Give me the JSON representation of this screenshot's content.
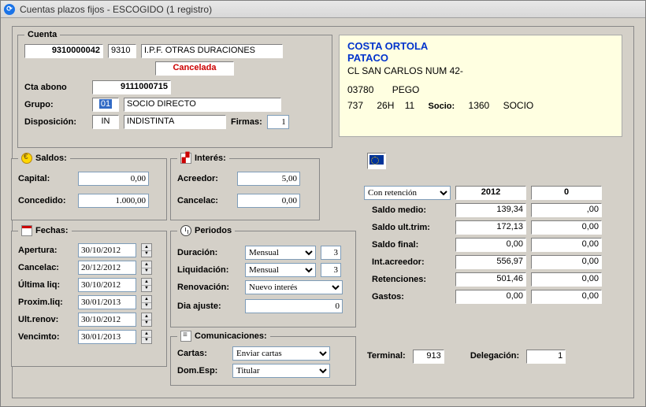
{
  "window": {
    "title": "Cuentas plazos fijos - ESCOGIDO (1 registro)"
  },
  "cuenta": {
    "legend": "Cuenta",
    "num": "9310000042",
    "tipo_cod": "9310",
    "tipo_desc": "I.P.F. OTRAS DURACIONES",
    "estado": "Cancelada",
    "cta_abono_label": "Cta abono",
    "cta_abono": "9111000715",
    "grupo_label": "Grupo:",
    "grupo_cod": "01",
    "grupo_desc": "SOCIO DIRECTO",
    "disposicion_label": "Disposición:",
    "disposicion_cod": "IN",
    "disposicion_desc": "INDISTINTA",
    "firmas_label": "Firmas:",
    "firmas": "1"
  },
  "cliente": {
    "nombre1": "COSTA ORTOLA",
    "nombre2": "PATACO",
    "direccion": "CL SAN CARLOS NUM 42-",
    "cp": "03780",
    "poblacion": "PEGO",
    "id1": "737",
    "id2": "26H",
    "id3": "11",
    "socio_label": "Socio:",
    "socio_num": "1360",
    "socio_tipo": "SOCIO"
  },
  "saldos": {
    "legend": "Saldos:",
    "capital_label": "Capital:",
    "capital": "0,00",
    "concedido_label": "Concedido:",
    "concedido": "1.000,00"
  },
  "interes": {
    "legend": "Interés:",
    "acreedor_label": "Acreedor:",
    "acreedor": "5,00",
    "cancelac_label": "Cancelac:",
    "cancelac": "0,00"
  },
  "fechas": {
    "legend": "Fechas:",
    "apertura_label": "Apertura:",
    "apertura": "30/10/2012",
    "cancelac_label": "Cancelac:",
    "cancelac": "20/12/2012",
    "ultima_liq_label": "Última liq:",
    "ultima_liq": "30/10/2012",
    "proxim_liq_label": "Proxim.liq:",
    "proxim_liq": "30/01/2013",
    "ult_renov_label": "Ult.renov:",
    "ult_renov": "30/10/2012",
    "vencimto_label": "Vencimto:",
    "vencimto": "30/01/2013"
  },
  "periodos": {
    "legend": "Periodos",
    "duracion_label": "Duración:",
    "duracion_sel": "Mensual",
    "duracion_n": "3",
    "liquidacion_label": "Liquidación:",
    "liquidacion_sel": "Mensual",
    "liquidacion_n": "3",
    "renovacion_label": "Renovación:",
    "renovacion_sel": "Nuevo interés",
    "dia_ajuste_label": "Dia ajuste:",
    "dia_ajuste": "0"
  },
  "comunicaciones": {
    "legend": "Comunicaciones:",
    "cartas_label": "Cartas:",
    "cartas_sel": "Enviar cartas",
    "dom_esp_label": "Dom.Esp:",
    "dom_esp_sel": "Titular"
  },
  "retencion": {
    "filtro": "Con retención",
    "anio": "2012",
    "col2": "0",
    "rows": [
      {
        "label": "Saldo medio:",
        "c1": "139,34",
        "c2": ",00"
      },
      {
        "label": "Saldo ult.trim:",
        "c1": "172,13",
        "c2": "0,00"
      },
      {
        "label": "Saldo final:",
        "c1": "0,00",
        "c2": "0,00"
      },
      {
        "label": "Int.acreedor:",
        "c1": "556,97",
        "c2": "0,00"
      },
      {
        "label": "Retenciones:",
        "c1": "501,46",
        "c2": "0,00"
      },
      {
        "label": "Gastos:",
        "c1": "0,00",
        "c2": "0,00"
      }
    ]
  },
  "footer": {
    "terminal_label": "Terminal:",
    "terminal": "913",
    "delegacion_label": "Delegación:",
    "delegacion": "1"
  }
}
